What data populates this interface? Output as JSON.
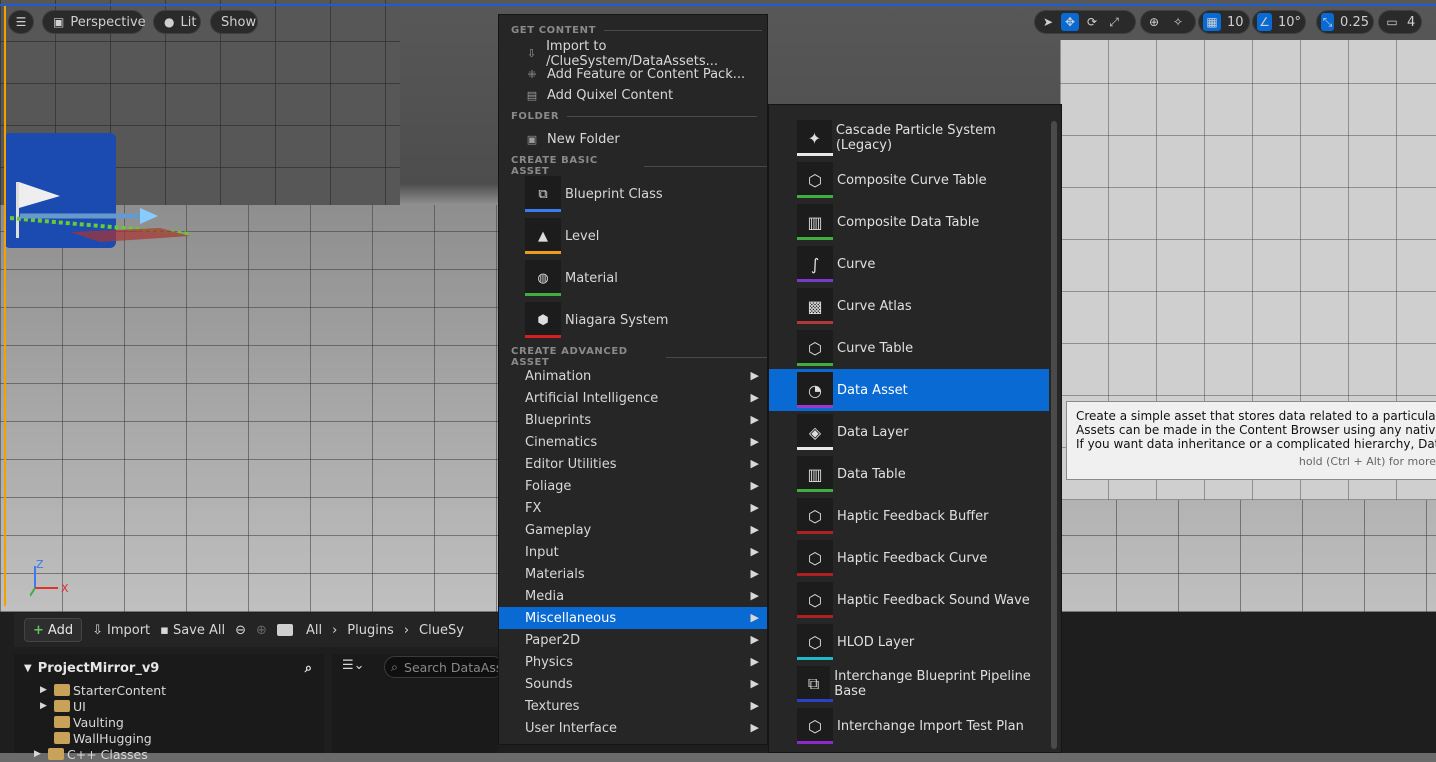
{
  "viewport_toolbar": {
    "perspective": "Perspective",
    "lit": "Lit",
    "show": "Show",
    "grid_snap": "10",
    "rotation_snap": "10°",
    "scale_snap": "0.25",
    "camera_speed": "4"
  },
  "menu": {
    "sections": {
      "get_content": "GET CONTENT",
      "folder": "FOLDER",
      "create_basic": "CREATE BASIC ASSET",
      "create_advanced": "CREATE ADVANCED ASSET"
    },
    "get_content_items": [
      {
        "label": "Import to /ClueSystem/DataAssets...",
        "icon": "import-icon"
      },
      {
        "label": "Add Feature or Content Pack...",
        "icon": "content-pack-icon"
      },
      {
        "label": "Add Quixel Content",
        "icon": "quixel-icon"
      }
    ],
    "folder_items": [
      {
        "label": "New Folder",
        "icon": "new-folder-icon"
      }
    ],
    "basic_assets": [
      {
        "label": "Blueprint Class",
        "icon": "blueprint-icon",
        "color": "#3a7cf0"
      },
      {
        "label": "Level",
        "icon": "level-icon",
        "color": "#f09a1a"
      },
      {
        "label": "Material",
        "icon": "material-icon",
        "color": "#3fae3f"
      },
      {
        "label": "Niagara System",
        "icon": "niagara-icon",
        "color": "#d42020"
      }
    ],
    "categories": [
      "Animation",
      "Artificial Intelligence",
      "Blueprints",
      "Cinematics",
      "Editor Utilities",
      "Foliage",
      "FX",
      "Gameplay",
      "Input",
      "Materials",
      "Media",
      "Miscellaneous",
      "Paper2D",
      "Physics",
      "Sounds",
      "Textures",
      "User Interface"
    ],
    "selected_category": "Miscellaneous"
  },
  "submenu": {
    "items": [
      {
        "label": "Cascade Particle System (Legacy)",
        "icon": "particle-icon",
        "color": "#e8e8e8"
      },
      {
        "label": "Composite Curve Table",
        "icon": "curve-table-icon",
        "color": "#3fae3f"
      },
      {
        "label": "Composite Data Table",
        "icon": "data-table-icon",
        "color": "#3fae3f"
      },
      {
        "label": "Curve",
        "icon": "curve-icon",
        "color": "#7a3ac8"
      },
      {
        "label": "Curve Atlas",
        "icon": "curve-atlas-icon",
        "color": "#b03a3a"
      },
      {
        "label": "Curve Table",
        "icon": "curve-table-icon",
        "color": "#3fae3f"
      },
      {
        "label": "Data Asset",
        "icon": "data-asset-icon",
        "color": "#9a3ac8"
      },
      {
        "label": "Data Layer",
        "icon": "data-layer-icon",
        "color": "#e8e8e8"
      },
      {
        "label": "Data Table",
        "icon": "data-table-icon",
        "color": "#3fae3f"
      },
      {
        "label": "Haptic Feedback Buffer",
        "icon": "haptic-icon",
        "color": "#b02020"
      },
      {
        "label": "Haptic Feedback Curve",
        "icon": "haptic-icon",
        "color": "#b02020"
      },
      {
        "label": "Haptic Feedback Sound Wave",
        "icon": "haptic-icon",
        "color": "#b02020"
      },
      {
        "label": "HLOD Layer",
        "icon": "hlod-icon",
        "color": "#20b8c8"
      },
      {
        "label": "Interchange Blueprint Pipeline Base",
        "icon": "blueprint-icon",
        "color": "#2a40c8"
      },
      {
        "label": "Interchange Import Test Plan",
        "icon": "test-plan-icon",
        "color": "#8a2ac8"
      }
    ],
    "selected": "Data Asset"
  },
  "tooltip": {
    "line1": "Create a simple asset that stores data related to a particular systen",
    "line2": "Assets can be made in the Content Browser using any native class",
    "line3": "If you want data inheritance or a complicated hierarchy, Data Only B",
    "hint": "hold (Ctrl + Alt) for more"
  },
  "content_browser": {
    "add": "Add",
    "import": "Import",
    "save_all": "Save All",
    "breadcrumb": [
      "All",
      "Plugins",
      "ClueSy"
    ],
    "project": "ProjectMirror_v9",
    "search_placeholder": "Search DataAss",
    "tree": [
      {
        "label": "StarterContent",
        "expandable": true
      },
      {
        "label": "UI",
        "expandable": true
      },
      {
        "label": "Vaulting",
        "expandable": false
      },
      {
        "label": "WallHugging",
        "expandable": false
      },
      {
        "label": "C++ Classes",
        "expandable": true
      }
    ]
  },
  "axis": {
    "x": "X",
    "z": "Z"
  }
}
